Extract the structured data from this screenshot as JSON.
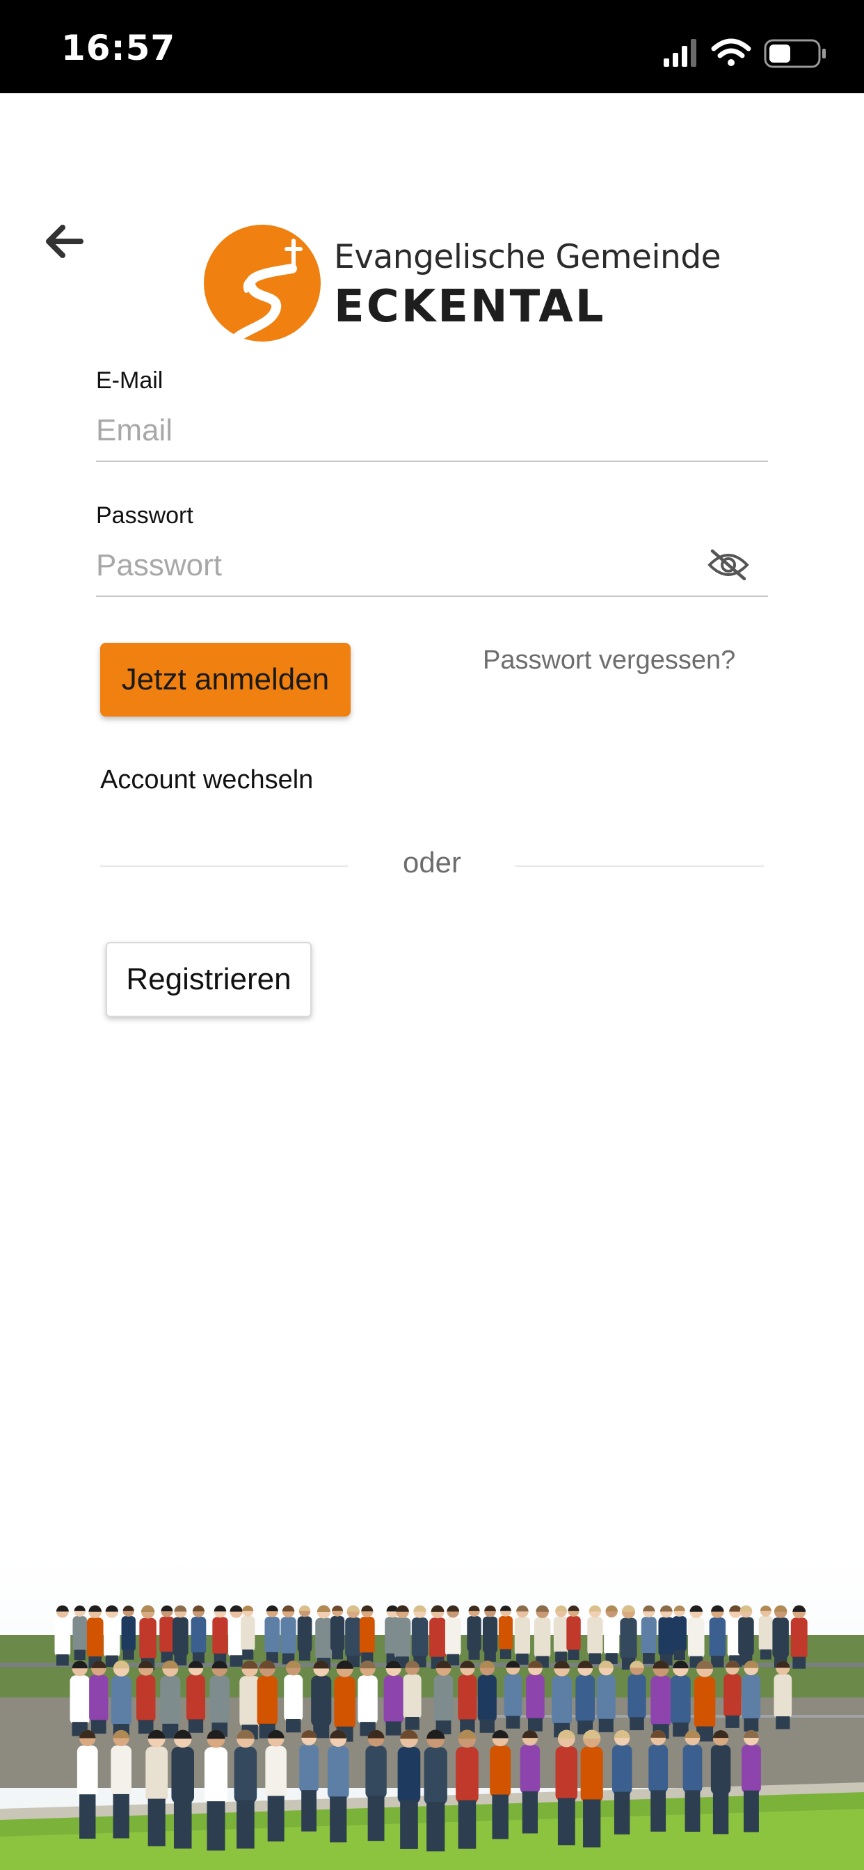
{
  "status_bar": {
    "time": "16:57",
    "icons": [
      "cellular-signal-icon",
      "wifi-icon",
      "battery-icon"
    ]
  },
  "header": {
    "back_icon": "arrow-left-icon",
    "logo": {
      "line1": "Evangelische Gemeinde",
      "line2": "ECKENTAL",
      "mark_icon": "church-path-cross-logo"
    }
  },
  "form": {
    "email": {
      "label": "E-Mail",
      "placeholder": "Email",
      "value": ""
    },
    "password": {
      "label": "Passwort",
      "placeholder": "Passwort",
      "value": "",
      "toggle_icon": "eye-slash-icon"
    },
    "login_label": "Jetzt anmelden",
    "forgot_label": "Passwort vergessen?",
    "switch_account_label": "Account wechseln",
    "divider_label": "oder",
    "register_label": "Registrieren"
  },
  "footer": {
    "image": "congregation-group-photo"
  },
  "colors": {
    "accent": "#f0800f",
    "status_bar_bg": "#000000",
    "muted_text": "#6d6d6d",
    "placeholder": "#a8a8a8"
  }
}
